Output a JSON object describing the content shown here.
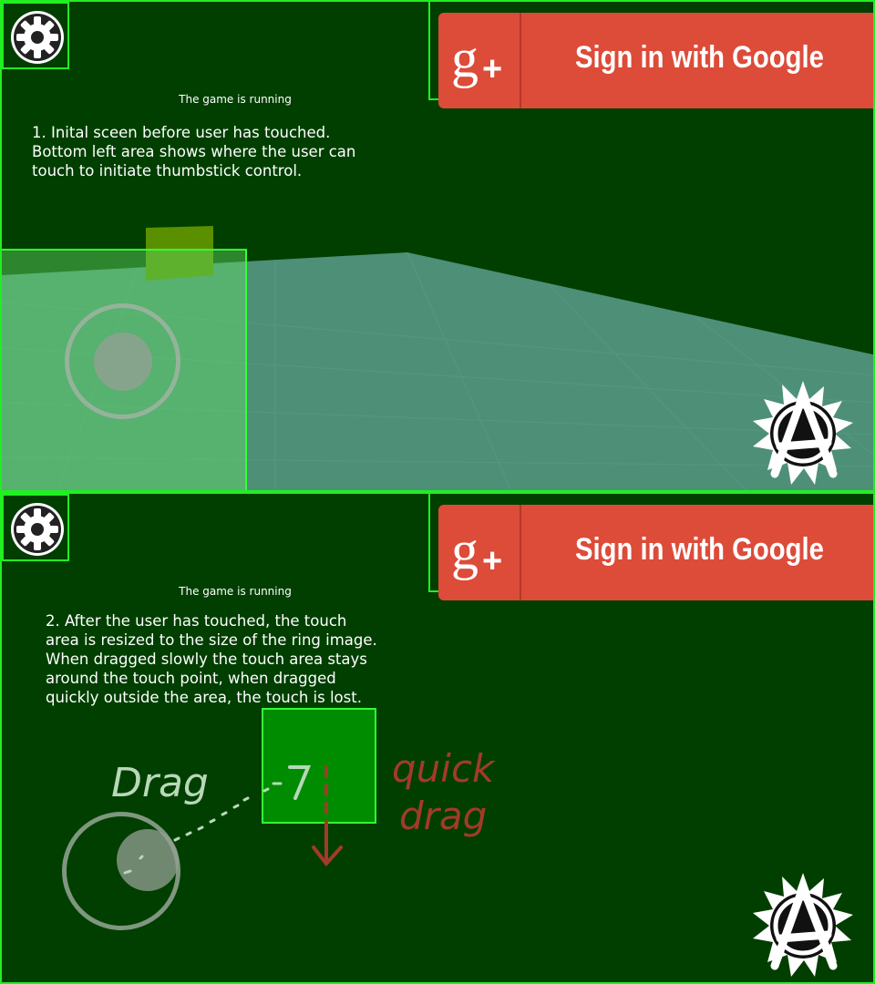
{
  "colors": {
    "background": "#003f00",
    "outline": "#22ee22",
    "google_red": "#dd4b39",
    "floor": "#4e8f78",
    "drag_annotation": "#b8d8b8",
    "quick_drag_annotation": "#a33a2a"
  },
  "icons": {
    "settings": "gear-icon",
    "google": "google-plus-icon",
    "logo": "anarchy-a-logo"
  },
  "panels": [
    {
      "status": "The game is running",
      "caption": "1. Inital sceen before user has touched.\nBottom left area shows where the user can\ntouch to initiate thumbstick control.",
      "google_button": "Sign in with Google"
    },
    {
      "status": "The game is running",
      "caption": "2. After the user has touched, the touch\narea is resized to the size of the ring image.\nWhen dragged slowly the touch area stays\naround the touch point, when dragged\nquickly outside the area, the touch is lost.",
      "google_button": "Sign in with Google",
      "annotations": {
        "drag": "Drag",
        "quick_drag_line1": "quick",
        "quick_drag_line2": "drag"
      }
    }
  ]
}
